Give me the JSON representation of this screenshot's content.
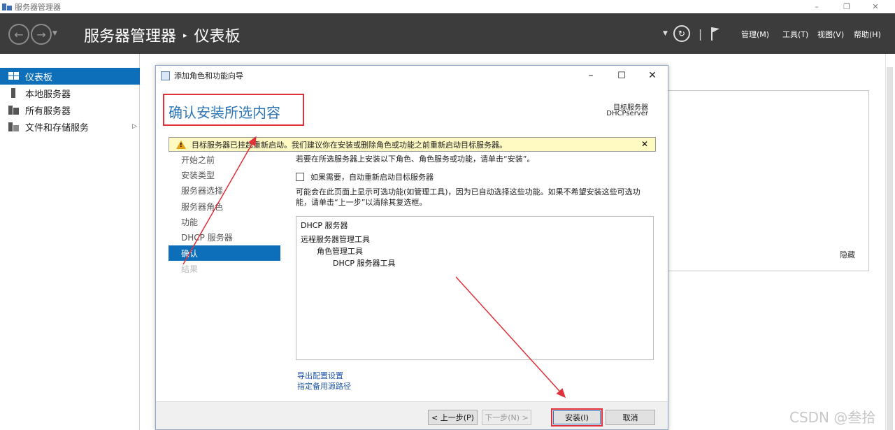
{
  "window": {
    "title": "服务器管理器",
    "controls": [
      "–",
      "❐",
      "✕"
    ]
  },
  "header": {
    "breadcrumb": [
      "服务器管理器",
      "仪表板"
    ],
    "menus": [
      "管理(M)",
      "工具(T)",
      "视图(V)",
      "帮助(H)"
    ]
  },
  "sidebar": {
    "items": [
      {
        "label": "仪表板",
        "icon": "dashboard-icon",
        "active": true
      },
      {
        "label": "本地服务器",
        "icon": "server-icon"
      },
      {
        "label": "所有服务器",
        "icon": "servers-icon"
      },
      {
        "label": "文件和存储服务",
        "icon": "storage-icon",
        "expandable": true
      }
    ]
  },
  "dashboard": {
    "hide_label": "隐藏"
  },
  "wizard": {
    "title": "添加角色和功能向导",
    "heading": "确认安装所选内容",
    "target_label": "目标服务器",
    "target_value": "DHCPserver",
    "warning": "目标服务器已挂起重新启动。我们建议你在安装或删除角色或功能之前重新启动目标服务器。",
    "steps": [
      {
        "label": "开始之前",
        "state": "normal"
      },
      {
        "label": "安装类型",
        "state": "normal"
      },
      {
        "label": "服务器选择",
        "state": "normal"
      },
      {
        "label": "服务器角色",
        "state": "normal"
      },
      {
        "label": "功能",
        "state": "normal"
      },
      {
        "label": "DHCP 服务器",
        "state": "normal"
      },
      {
        "label": "确认",
        "state": "active"
      },
      {
        "label": "结果",
        "state": "disabled"
      }
    ],
    "intro": "若要在所选服务器上安装以下角色、角色服务或功能，请单击“安装”。",
    "restart_checkbox": {
      "label": "如果需要，自动重新启动目标服务器",
      "checked": false
    },
    "note_line1": "可能会在此页面上显示可选功能(如管理工具)，因为已自动选择这些功能。如果不希望安装这些可选功",
    "note_line2": "能，请单击“上一步”以清除其复选框。",
    "tree": [
      {
        "text": "DHCP 服务器",
        "level": 0
      },
      {
        "text": "远程服务器管理工具",
        "level": 0
      },
      {
        "text": "角色管理工具",
        "level": 1
      },
      {
        "text": "DHCP 服务器工具",
        "level": 2
      }
    ],
    "links": [
      "导出配置设置",
      "指定备用源路径"
    ],
    "buttons": {
      "previous": "< 上一步(P)",
      "next": "下一步(N) >",
      "install": "安装(I)",
      "cancel": "取消"
    }
  },
  "watermark": "CSDN @叁拾",
  "colors": {
    "accent": "#0d6fba",
    "header_bg": "#3c3c3c",
    "heading": "#2e75b6",
    "annotation": "#e0303a",
    "warning_bg": "#fff9c2"
  }
}
